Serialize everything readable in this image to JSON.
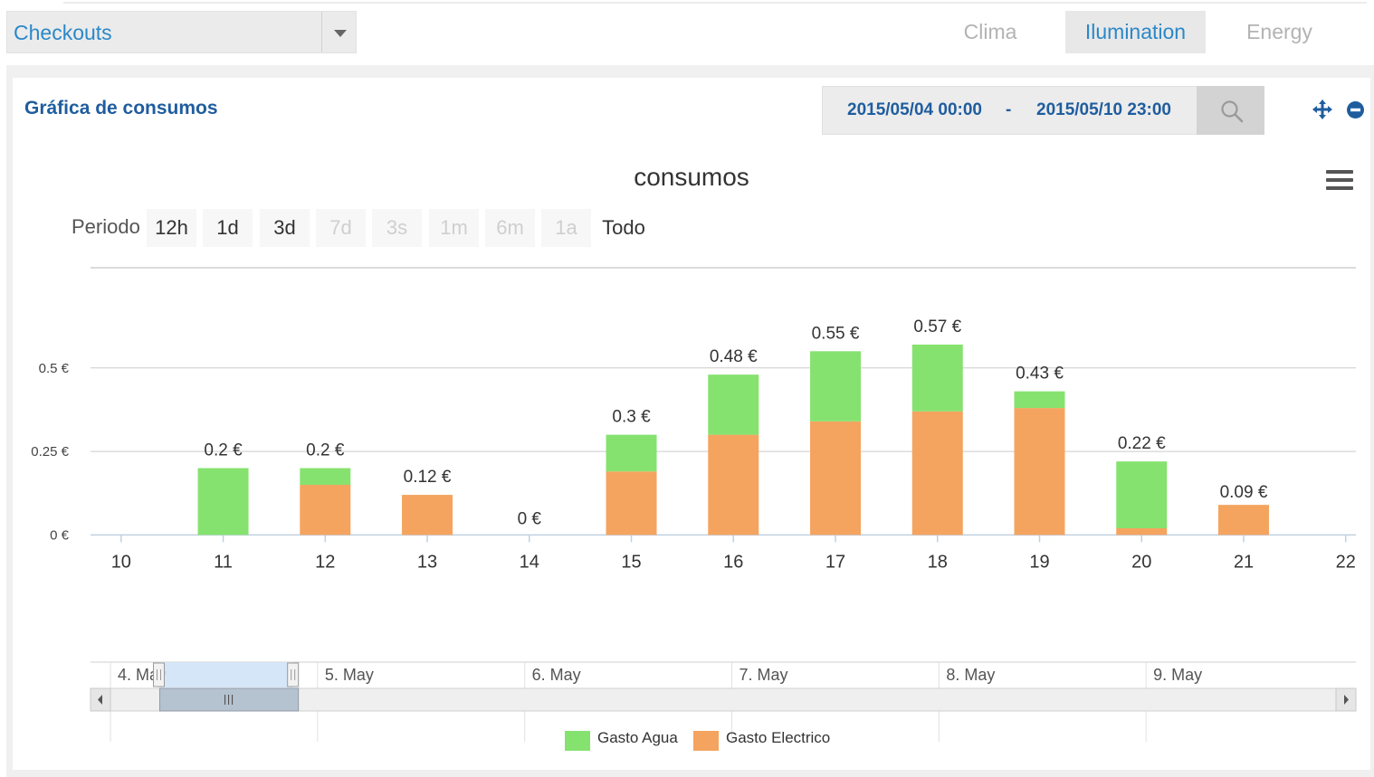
{
  "site_selector": {
    "value": "Checkouts"
  },
  "tabs": [
    {
      "label": "Clima",
      "active": false
    },
    {
      "label": "Ilumination",
      "active": true
    },
    {
      "label": "Energy",
      "active": false
    }
  ],
  "panel": {
    "title": "Gráfica de consumos"
  },
  "date_range": {
    "from": "2015/05/04 00:00",
    "separator": "-",
    "to": "2015/05/10 23:00"
  },
  "period": {
    "label": "Periodo",
    "buttons": [
      {
        "label": "12h",
        "enabled": true
      },
      {
        "label": "1d",
        "enabled": true
      },
      {
        "label": "3d",
        "enabled": true
      },
      {
        "label": "7d",
        "enabled": false
      },
      {
        "label": "3s",
        "enabled": false
      },
      {
        "label": "1m",
        "enabled": false
      },
      {
        "label": "6m",
        "enabled": false
      },
      {
        "label": "1a",
        "enabled": false
      },
      {
        "label": "Todo",
        "enabled": true
      }
    ]
  },
  "colors": {
    "agua": "#86e26f",
    "electrico": "#f4a45f",
    "accent": "#2a88c8",
    "title": "#1f5d9e"
  },
  "chart_data": {
    "type": "bar",
    "stacked": true,
    "title": "consumos",
    "categories": [
      "11",
      "12",
      "13",
      "14",
      "15",
      "16",
      "17",
      "18",
      "19",
      "20",
      "21"
    ],
    "x_ticks": [
      "10",
      "11",
      "12",
      "13",
      "14",
      "15",
      "16",
      "17",
      "18",
      "19",
      "20",
      "21",
      "22"
    ],
    "series": [
      {
        "name": "Gasto Agua",
        "color": "#86e26f",
        "values": [
          0.2,
          0.05,
          0.0,
          0.0,
          0.11,
          0.18,
          0.21,
          0.2,
          0.05,
          0.2,
          0.0
        ]
      },
      {
        "name": "Gasto Electrico",
        "color": "#f4a45f",
        "values": [
          0.0,
          0.15,
          0.12,
          0.0,
          0.19,
          0.3,
          0.34,
          0.37,
          0.38,
          0.02,
          0.09
        ]
      }
    ],
    "totals_labels": [
      "0.2 €",
      "0.2 €",
      "0.12 €",
      "0 €",
      "0.3 €",
      "0.48 €",
      "0.55 €",
      "0.57 €",
      "0.43 €",
      "0.22 €",
      "0.09 €"
    ],
    "y_ticks": [
      {
        "value": 0,
        "label": "0 €"
      },
      {
        "value": 0.25,
        "label": "0.25 €"
      },
      {
        "value": 0.5,
        "label": "0.5 €"
      }
    ],
    "ylim": [
      -0.175,
      0.8
    ],
    "xlim": [
      9.7,
      22.1
    ],
    "legend_position": "bottom",
    "navigator": {
      "labels": [
        "4. May",
        "5. May",
        "6. May",
        "7. May",
        "8. May",
        "9. May"
      ],
      "window": [
        0.054,
        0.16
      ]
    }
  }
}
